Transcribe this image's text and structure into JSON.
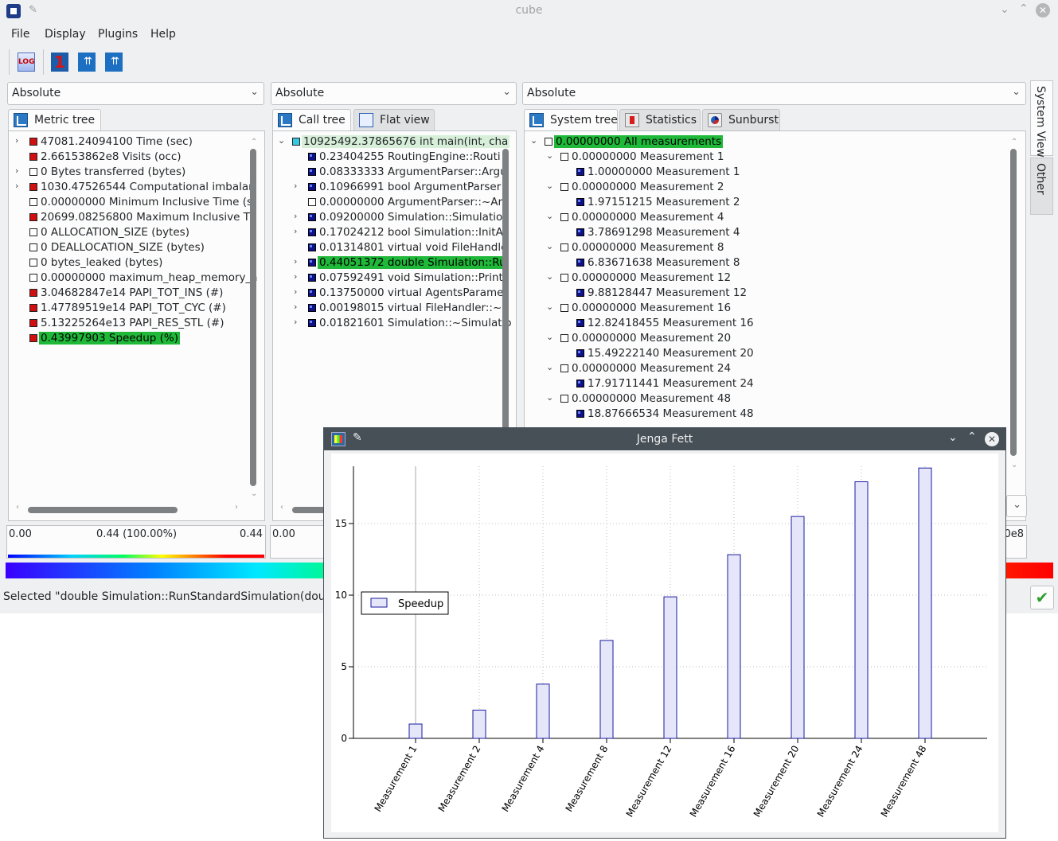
{
  "window": {
    "title": "cube"
  },
  "menu": [
    "File",
    "Display",
    "Plugins",
    "Help"
  ],
  "toolbar": {
    "log_label": "LOG",
    "one_label": "1"
  },
  "combos": {
    "metric": "Absolute",
    "call": "Absolute",
    "system": "Absolute"
  },
  "tabs": {
    "metric": "Metric tree",
    "call": "Call tree",
    "flat": "Flat view",
    "system": "System tree",
    "statistics": "Statistics",
    "sunburst": "Sunburst"
  },
  "side_tabs": {
    "system_view": "System View",
    "other": "Other"
  },
  "metric_tree": [
    {
      "exp": "›",
      "color": "red",
      "text": "47081.24094100 Time (sec)"
    },
    {
      "exp": "",
      "color": "red",
      "text": "2.66153862e8 Visits (occ)"
    },
    {
      "exp": "›",
      "color": "white",
      "text": "0 Bytes transferred (bytes)"
    },
    {
      "exp": "›",
      "color": "red",
      "text": "1030.47526544 Computational imbalar"
    },
    {
      "exp": "",
      "color": "white",
      "text": "0.00000000 Minimum Inclusive Time (s"
    },
    {
      "exp": "",
      "color": "red",
      "text": "20699.08256800 Maximum Inclusive Ti"
    },
    {
      "exp": "",
      "color": "white",
      "text": "0 ALLOCATION_SIZE (bytes)"
    },
    {
      "exp": "",
      "color": "white",
      "text": "0 DEALLOCATION_SIZE (bytes)"
    },
    {
      "exp": "",
      "color": "white",
      "text": "0 bytes_leaked (bytes)"
    },
    {
      "exp": "",
      "color": "white",
      "text": "0.00000000 maximum_heap_memory_a"
    },
    {
      "exp": "",
      "color": "red",
      "text": "3.04682847e14 PAPI_TOT_INS (#)"
    },
    {
      "exp": "",
      "color": "red",
      "text": "1.47789519e14 PAPI_TOT_CYC (#)"
    },
    {
      "exp": "",
      "color": "red",
      "text": "5.13225264e13 PAPI_RES_STL (#)"
    },
    {
      "exp": "",
      "color": "red",
      "text": "0.43997903 Speedup (%)",
      "selected": true
    }
  ],
  "call_tree": [
    {
      "exp": "⌄",
      "color": "cyan",
      "text": "10925492.37865676 int main(int, cha",
      "root": true
    },
    {
      "exp": "",
      "color": "blue",
      "text": "0.23404255 RoutingEngine::Routi"
    },
    {
      "exp": "",
      "color": "blue",
      "text": "0.08333333 ArgumentParser::Argu"
    },
    {
      "exp": "›",
      "color": "blue",
      "text": "0.10966991 bool ArgumentParser"
    },
    {
      "exp": "",
      "color": "white",
      "text": "0.00000000 ArgumentParser::~Arg"
    },
    {
      "exp": "›",
      "color": "blue",
      "text": "0.09200000 Simulation::Simulatior"
    },
    {
      "exp": "›",
      "color": "blue",
      "text": "0.17024212 bool Simulation::InitA"
    },
    {
      "exp": "",
      "color": "blue",
      "text": "0.01314801 virtual void FileHandle"
    },
    {
      "exp": "›",
      "color": "blue",
      "text": "0.44051372 double Simulation::Ru",
      "selected": true
    },
    {
      "exp": "›",
      "color": "blue",
      "text": "0.07592491 void Simulation::Print"
    },
    {
      "exp": "›",
      "color": "blue",
      "text": "0.13750000 virtual AgentsParame"
    },
    {
      "exp": "›",
      "color": "blue",
      "text": "0.00198015 virtual FileHandler::~F"
    },
    {
      "exp": "›",
      "color": "blue",
      "text": "0.01821601 Simulation::~Simulatio"
    }
  ],
  "system_tree": [
    {
      "level": 0,
      "exp": "⌄",
      "color": "white",
      "text": "0.00000000 All measurements",
      "selected": true
    },
    {
      "level": 1,
      "exp": "⌄",
      "color": "white",
      "text": "0.00000000 Measurement 1"
    },
    {
      "level": 2,
      "exp": "",
      "color": "blue",
      "text": "1.00000000 Measurement 1"
    },
    {
      "level": 1,
      "exp": "⌄",
      "color": "white",
      "text": "0.00000000 Measurement 2"
    },
    {
      "level": 2,
      "exp": "",
      "color": "blue",
      "text": "1.97151215 Measurement 2"
    },
    {
      "level": 1,
      "exp": "⌄",
      "color": "white",
      "text": "0.00000000 Measurement 4"
    },
    {
      "level": 2,
      "exp": "",
      "color": "blue",
      "text": "3.78691298 Measurement 4"
    },
    {
      "level": 1,
      "exp": "⌄",
      "color": "white",
      "text": "0.00000000 Measurement 8"
    },
    {
      "level": 2,
      "exp": "",
      "color": "blue",
      "text": "6.83671638 Measurement 8"
    },
    {
      "level": 1,
      "exp": "⌄",
      "color": "white",
      "text": "0.00000000 Measurement 12"
    },
    {
      "level": 2,
      "exp": "",
      "color": "blue",
      "text": "9.88128447 Measurement 12"
    },
    {
      "level": 1,
      "exp": "⌄",
      "color": "white",
      "text": "0.00000000 Measurement 16"
    },
    {
      "level": 2,
      "exp": "",
      "color": "blue",
      "text": "12.82418455 Measurement 16"
    },
    {
      "level": 1,
      "exp": "⌄",
      "color": "white",
      "text": "0.00000000 Measurement 20"
    },
    {
      "level": 2,
      "exp": "",
      "color": "blue",
      "text": "15.49222140 Measurement 20"
    },
    {
      "level": 1,
      "exp": "⌄",
      "color": "white",
      "text": "0.00000000 Measurement 24"
    },
    {
      "level": 2,
      "exp": "",
      "color": "blue",
      "text": "17.91711441 Measurement 24"
    },
    {
      "level": 1,
      "exp": "⌄",
      "color": "white",
      "text": "0.00000000 Measurement 48"
    },
    {
      "level": 2,
      "exp": "",
      "color": "blue",
      "text": "18.87666534 Measurement 48"
    }
  ],
  "metric_range": {
    "min": "0.00",
    "mid": "0.44 (100.00%)",
    "max": "0.44"
  },
  "call_range": {
    "min": "0.00"
  },
  "system_range": {
    "max_partial": "0e8"
  },
  "status": "Selected \"double Simulation::RunStandardSimulation(double)\"",
  "colors": {
    "selection": "#1fb839",
    "bar_fill": "#e6e6fa",
    "bar_stroke": "#1a1aa0"
  },
  "plot_window": {
    "title": "Jenga Fett"
  },
  "chart_data": {
    "type": "bar",
    "categories": [
      "Measurement 1",
      "Measurement 2",
      "Measurement 4",
      "Measurement 8",
      "Measurement 12",
      "Measurement 16",
      "Measurement 20",
      "Measurement 24",
      "Measurement 48"
    ],
    "series": [
      {
        "name": "Speedup",
        "values": [
          1.0,
          1.97151215,
          3.78691298,
          6.83671638,
          9.88128447,
          12.82418455,
          15.4922214,
          17.91711441,
          18.87666534
        ]
      }
    ],
    "yticks": [
      0,
      5,
      10,
      15
    ],
    "ylim": [
      0,
      19
    ],
    "grid": true,
    "legend": "left"
  }
}
